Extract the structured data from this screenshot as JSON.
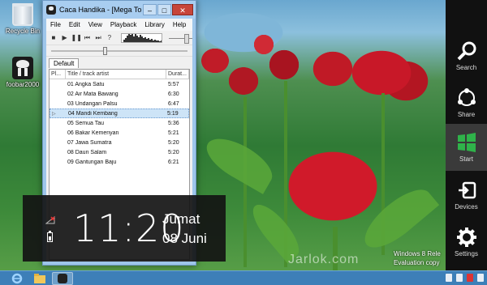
{
  "desktop": {
    "icons": [
      {
        "label": "Recycle Bin",
        "icon": "recycle-bin-icon"
      },
      {
        "label": "foobar2000",
        "icon": "foobar-icon"
      }
    ],
    "watermark_line1": "Windows 8 Rele",
    "watermark_line2": "Evaluation copy",
    "site": "Jarlok.com"
  },
  "window": {
    "title": "Caca Handika - [Mega Top Be...",
    "menu": [
      "File",
      "Edit",
      "View",
      "Playback",
      "Library",
      "Help"
    ],
    "tab": "Default",
    "columns": {
      "playing": "Pl...",
      "title": "Title / track artist",
      "duration": "Durat..."
    },
    "tracks": [
      {
        "title": "01 Angka Satu",
        "duration": "5:57"
      },
      {
        "title": "02 Air Mata Bawang",
        "duration": "6:30"
      },
      {
        "title": "03 Undangan Palsu",
        "duration": "6:47"
      },
      {
        "title": "04 Mandi Kembang",
        "duration": "5:19",
        "selected": true
      },
      {
        "title": "05 Semua Tau",
        "duration": "5:36"
      },
      {
        "title": "06 Bakar Kemenyan",
        "duration": "5:21"
      },
      {
        "title": "07 Jawa Sumatra",
        "duration": "5:20"
      },
      {
        "title": "08 Daun Salam",
        "duration": "5:20"
      },
      {
        "title": "09 Gantungan Baju",
        "duration": "6:21"
      }
    ]
  },
  "clock": {
    "time": "11:20",
    "day": "Jumat",
    "date": "08 Juni"
  },
  "charms": [
    {
      "label": "Search",
      "icon": "search-icon"
    },
    {
      "label": "Share",
      "icon": "share-icon"
    },
    {
      "label": "Start",
      "icon": "windows-logo-icon"
    },
    {
      "label": "Devices",
      "icon": "devices-icon"
    },
    {
      "label": "Settings",
      "icon": "gear-icon"
    }
  ],
  "colors": {
    "charms_bg": "#111111",
    "start_logo": "#2fb34a",
    "taskbar": "#3d7fb8"
  }
}
